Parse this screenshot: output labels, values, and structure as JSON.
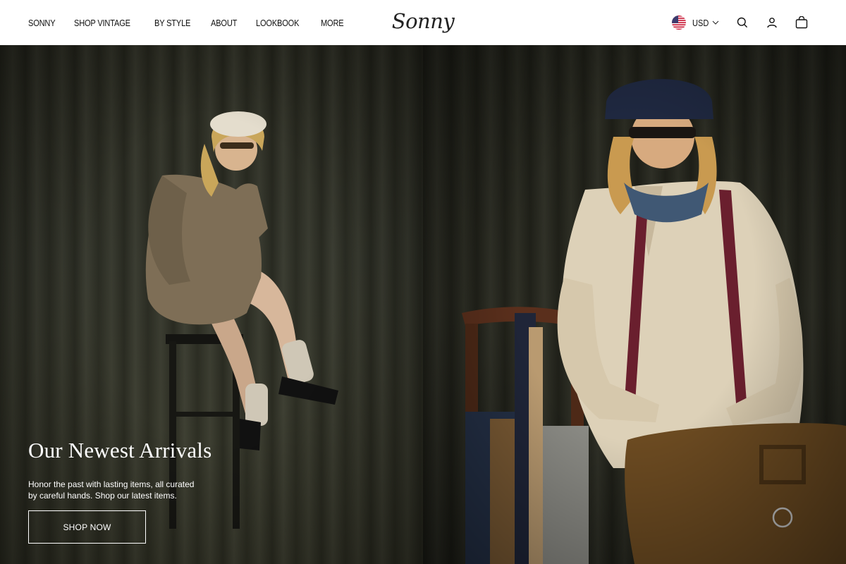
{
  "nav": {
    "items": [
      {
        "label": "SONNY"
      },
      {
        "label": "SHOP VINTAGE"
      },
      {
        "label": "BY STYLE"
      },
      {
        "label": "ABOUT"
      },
      {
        "label": "LOOKBOOK"
      },
      {
        "label": "MORE"
      }
    ]
  },
  "brand": {
    "logo_text": "Sonny"
  },
  "header_right": {
    "currency_label": "USD",
    "currency_flag_icon": "us-flag-icon",
    "icons": [
      "search-icon",
      "account-icon",
      "cart-icon"
    ]
  },
  "hero": {
    "title": "Our Newest Arrivals",
    "subtitle": "Honor the past with lasting items, all curated by careful hands. Shop our latest items.",
    "cta_label": "SHOP NOW"
  },
  "colors": {
    "header_bg": "#ffffff",
    "text_dark": "#111111",
    "hero_text": "#ffffff"
  }
}
